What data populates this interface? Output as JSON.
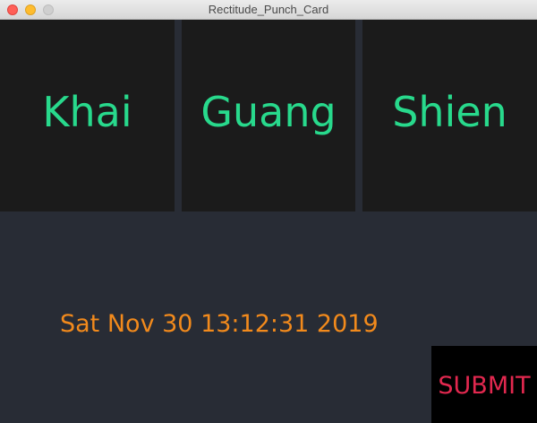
{
  "window": {
    "title": "Rectitude_Punch_Card"
  },
  "names": [
    {
      "label": "Khai"
    },
    {
      "label": "Guang"
    },
    {
      "label": "Shien"
    }
  ],
  "datetime_text": "Sat Nov 30 13:12:31 2019",
  "submit_label": "SUBMIT",
  "colors": {
    "background": "#282c35",
    "tile": "#1b1b1b",
    "name_text": "#28d98c",
    "datetime_text": "#f28a1c",
    "submit_text": "#e2284f",
    "submit_bg": "#000000"
  }
}
